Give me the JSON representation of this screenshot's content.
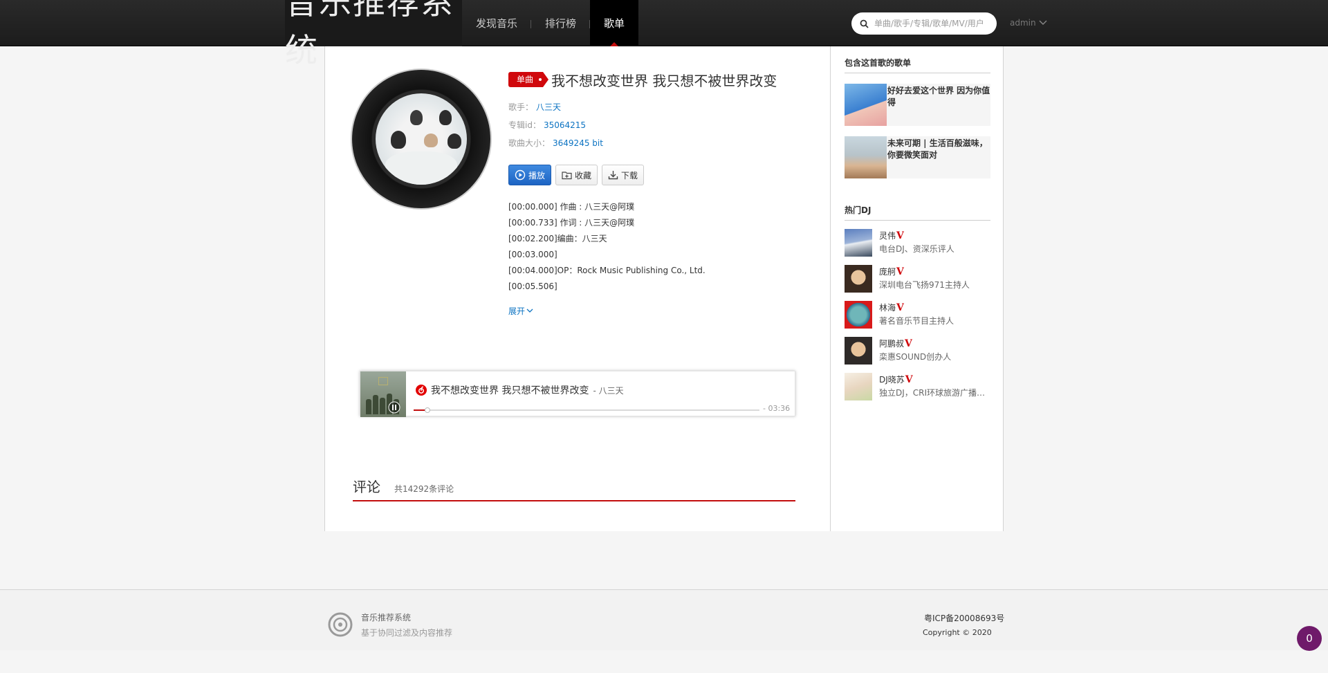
{
  "header": {
    "logo_text": "音乐推荐系统",
    "nav": [
      "发现音乐",
      "排行榜",
      "歌单"
    ],
    "active_nav": "歌单",
    "search_placeholder": "单曲/歌手/专辑/歌单/MV/用户",
    "user_name": "admin"
  },
  "song": {
    "tag": "单曲",
    "title": "我不想改变世界 我只想不被世界改变",
    "singer_label": "歌手：",
    "singer": "八三天",
    "album_label": "专辑id：",
    "album_id": "35064215",
    "size_label": "歌曲大小：",
    "size": "3649245 bit",
    "play_label": "播放",
    "collect_label": "收藏",
    "download_label": "下载",
    "lyrics": [
      "[00:00.000] 作曲 : 八三天@阿璞",
      "[00:00.733] 作词 : 八三天@阿璞",
      "[00:02.200]编曲：八三天",
      "[00:03.000]",
      "[00:04.000]OP：Rock Music Publishing Co., Ltd.",
      "[00:05.506]"
    ],
    "expand_label": "展开"
  },
  "player": {
    "title": "我不想改变世界 我只想不被世界改变",
    "artist": "- 八三天",
    "time": "- 03:36",
    "progress": 0.04
  },
  "comments": {
    "title": "评论",
    "count_text": "共14292条评论"
  },
  "sidebar": {
    "playlists_title": "包含这首歌的歌单",
    "playlists": [
      {
        "name": "好好去爱这个世界 因为你值得"
      },
      {
        "name": "未来可期 | 生活百般滋味，你要微笑面对"
      }
    ],
    "dj_title": "热门DJ",
    "djs": [
      {
        "name": "灵伟",
        "desc": "电台DJ、资深乐评人"
      },
      {
        "name": "庞舸",
        "desc": "深圳电台飞扬971主持人"
      },
      {
        "name": "林海",
        "desc": "著名音乐节目主持人"
      },
      {
        "name": "阿鹏叔",
        "desc": "栾惠SOUND创办人"
      },
      {
        "name": "DJ晓苏",
        "desc": "独立DJ，CRI环球旅游广播特邀DJ"
      }
    ],
    "verified_mark": "V"
  },
  "footer": {
    "name": "音乐推荐系统",
    "subtitle": "基于协同过滤及内容推荐",
    "icp": "粤ICP备20008693号",
    "copyright": "Copyright © 2020"
  },
  "badge_count": "0",
  "colors": {
    "accent_red": "#c20c0c",
    "link_blue": "#0c73c2",
    "primary_btn": "#2a74d1",
    "badge_purple": "#6f1a6a"
  }
}
